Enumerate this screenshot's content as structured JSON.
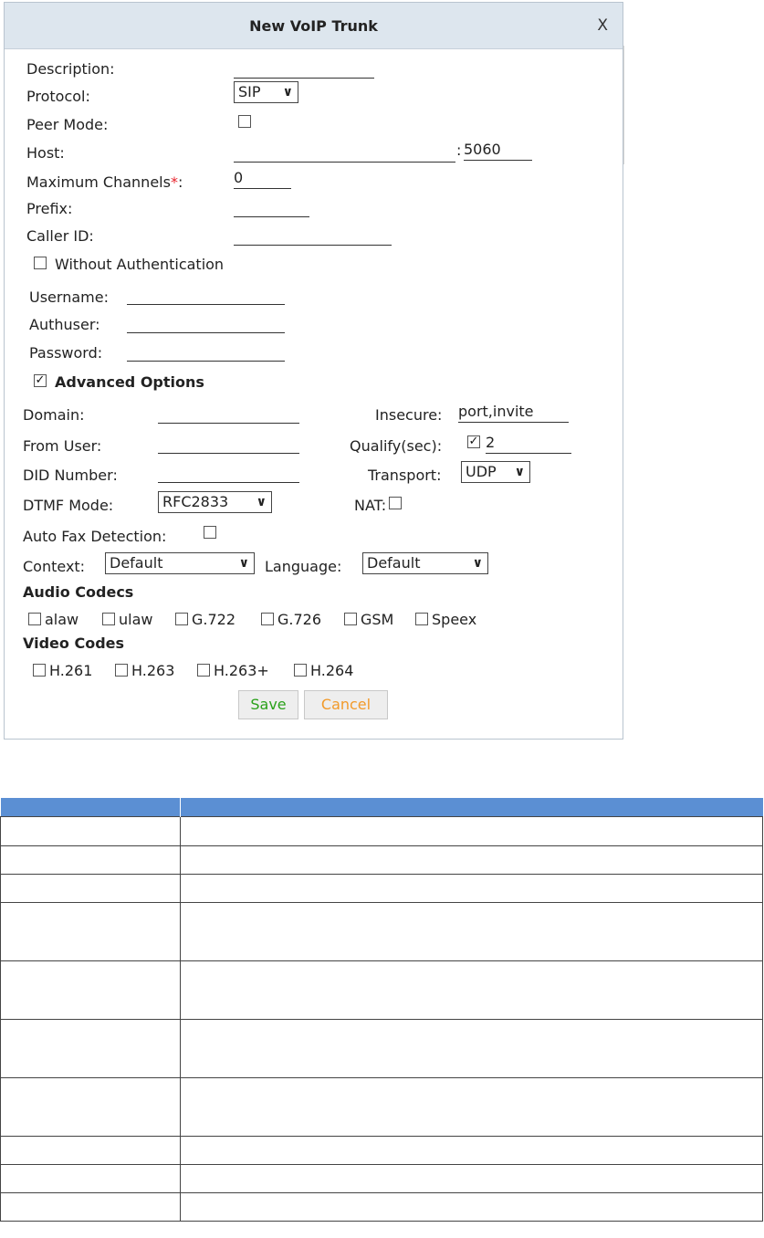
{
  "dialog": {
    "title": "New VoIP Trunk",
    "close_label": "X",
    "description_label": "Description:",
    "protocol_label": "Protocol:",
    "protocol_value": "SIP",
    "peer_mode_label": "Peer Mode:",
    "host_label": "Host:",
    "host_port_sep": ":",
    "host_port": "5060",
    "max_channels_label": "Maximum Channels",
    "max_channels_required": "*",
    "max_channels_colon": ":",
    "max_channels_value": "0",
    "prefix_label": "Prefix:",
    "caller_id_label": "Caller ID:",
    "without_auth_label": "Without Authentication",
    "username_label": "Username:",
    "authuser_label": "Authuser:",
    "password_label": "Password:",
    "advanced_label": "Advanced Options",
    "domain_label": "Domain:",
    "insecure_label": "Insecure:",
    "insecure_value": "port,invite",
    "from_user_label": "From User:",
    "qualify_label": "Qualify(sec):",
    "qualify_value": "2",
    "did_label": "DID Number:",
    "transport_label": "Transport:",
    "transport_value": "UDP",
    "dtmf_label": "DTMF Mode:",
    "dtmf_value": "RFC2833",
    "nat_label": "NAT:",
    "fax_label": "Auto Fax Detection:",
    "context_label": "Context:",
    "context_value": "Default",
    "language_label": "Language:",
    "language_value": "Default",
    "audio_codecs_label": "Audio Codecs",
    "audio_codecs": [
      "alaw",
      "ulaw",
      "G.722",
      "G.726",
      "GSM",
      "Speex"
    ],
    "video_codecs_label": "Video Codes",
    "video_codecs": [
      "H.261",
      "H.263",
      "H.263+",
      "H.264"
    ],
    "save_label": "Save",
    "cancel_label": "Cancel",
    "checked_mark": "✓",
    "chevron": "∨"
  },
  "colors": {
    "title_bar": "#dde6ee",
    "table_header": "#5b8fd3",
    "required": "#e8232c",
    "save_text": "#2aa11a",
    "cancel_text": "#f29a2a"
  }
}
